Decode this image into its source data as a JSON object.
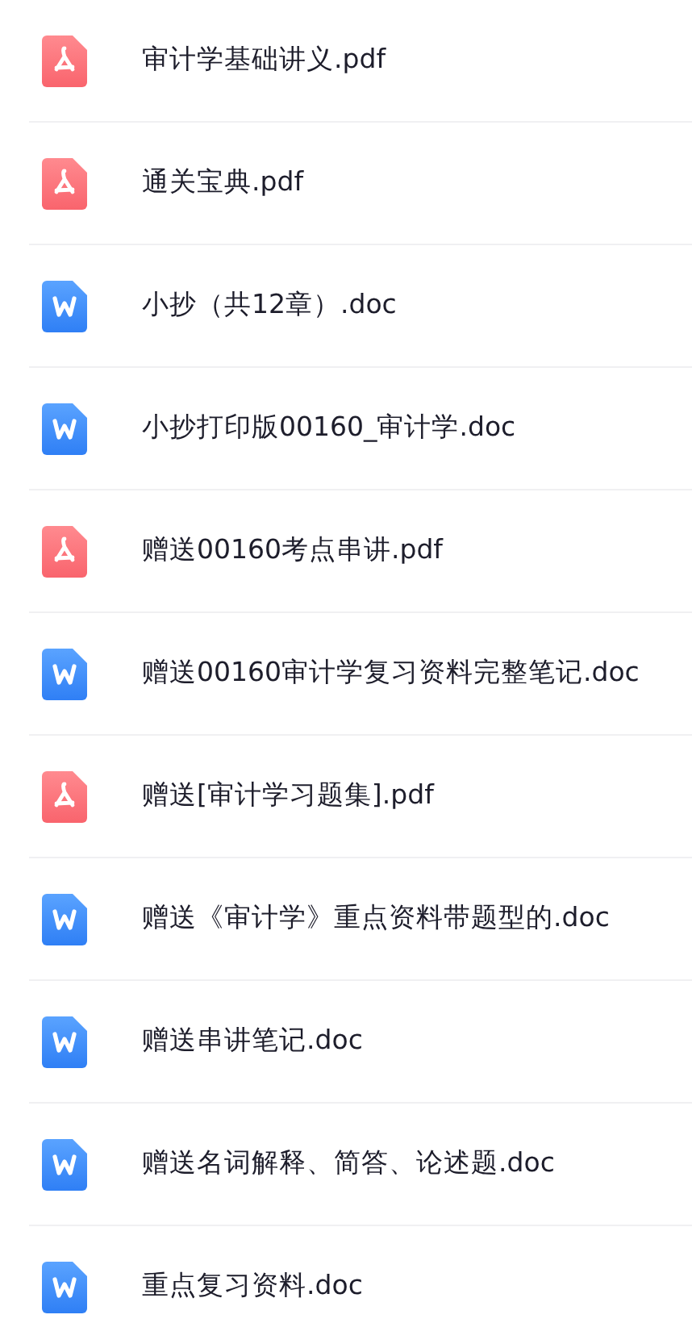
{
  "files": [
    {
      "name": "审计学基础讲义.pdf",
      "kind": "pdf"
    },
    {
      "name": "通关宝典.pdf",
      "kind": "pdf"
    },
    {
      "name": "小抄（共12章）.doc",
      "kind": "doc"
    },
    {
      "name": "小抄打印版00160_审计学.doc",
      "kind": "doc"
    },
    {
      "name": "赠送00160考点串讲.pdf",
      "kind": "pdf"
    },
    {
      "name": "赠送00160审计学复习资料完整笔记.doc",
      "kind": "doc"
    },
    {
      "name": "赠送[审计学习题集].pdf",
      "kind": "pdf"
    },
    {
      "name": "赠送《审计学》重点资料带题型的.doc",
      "kind": "doc"
    },
    {
      "name": "赠送串讲笔记.doc",
      "kind": "doc"
    },
    {
      "name": "赠送名词解释、简答、论述题.doc",
      "kind": "doc"
    },
    {
      "name": "重点复习资料.doc",
      "kind": "doc"
    }
  ]
}
